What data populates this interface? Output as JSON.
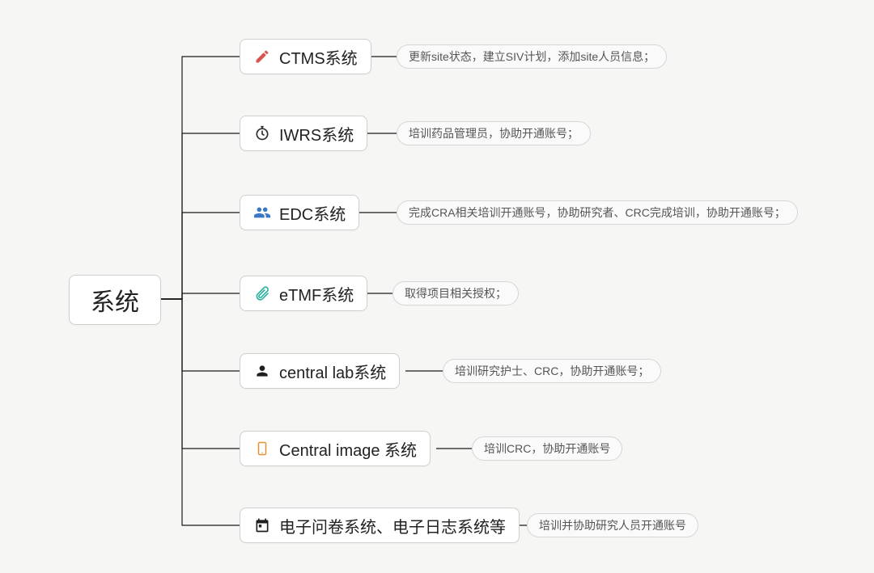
{
  "root": {
    "label": "系统"
  },
  "items": [
    {
      "icon": "pencil-icon",
      "icon_color": "#d9534f",
      "label": "CTMS系统",
      "desc": "更新site状态，建立SIV计划，添加site人员信息；"
    },
    {
      "icon": "stopwatch-icon",
      "icon_color": "#2f2f2f",
      "label": "IWRS系统",
      "desc": "培训药品管理员，协助开通账号；"
    },
    {
      "icon": "users-icon",
      "icon_color": "#3b78c4",
      "label": "EDC系统",
      "desc": "完成CRA相关培训开通账号，协助研究者、CRC完成培训，协助开通账号；"
    },
    {
      "icon": "paperclip-icon",
      "icon_color": "#2fb2a0",
      "label": "eTMF系统",
      "desc": "取得项目相关授权；"
    },
    {
      "icon": "user-icon",
      "icon_color": "#1f1f1f",
      "label": "central lab系统",
      "desc": "培训研究护士、CRC，协助开通账号；"
    },
    {
      "icon": "mobile-icon",
      "icon_color": "#e59232",
      "label": "Central image 系统",
      "desc": "培训CRC，协助开通账号"
    },
    {
      "icon": "calendar-icon",
      "icon_color": "#1f1f1f",
      "label": "电子问卷系统、电子日志系统等",
      "desc": "培训并协助研究人员开通账号"
    }
  ]
}
